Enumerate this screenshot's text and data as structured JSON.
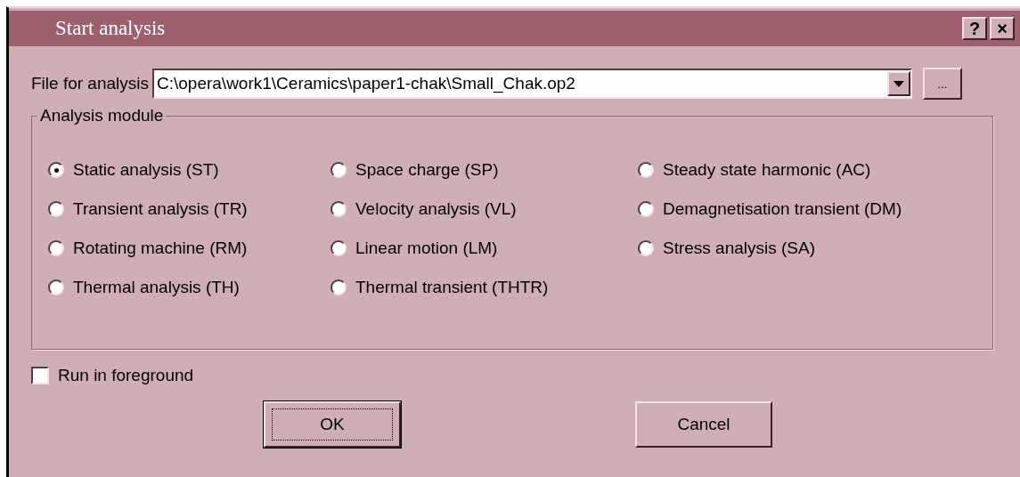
{
  "window": {
    "title": "Start analysis",
    "buttons": [
      {
        "label": "?"
      },
      {
        "label": "×"
      }
    ]
  },
  "file": {
    "label": "File for analysis",
    "value": "C:\\opera\\work1\\Ceramics\\paper1-chak\\Small_Chak.op2",
    "browse": "..."
  },
  "module": {
    "title": "Analysis module",
    "options": [
      {
        "label": "Static analysis (ST)",
        "selected": true
      },
      {
        "label": "Space charge (SP)",
        "selected": false
      },
      {
        "label": "Steady state harmonic (AC)",
        "selected": false
      },
      {
        "label": "Transient analysis (TR)",
        "selected": false
      },
      {
        "label": "Velocity analysis (VL)",
        "selected": false
      },
      {
        "label": "Demagnetisation transient (DM)",
        "selected": false
      },
      {
        "label": "Rotating machine (RM)",
        "selected": false
      },
      {
        "label": "Linear motion (LM)",
        "selected": false
      },
      {
        "label": "Stress analysis (SA)",
        "selected": false
      },
      {
        "label": "Thermal analysis (TH)",
        "selected": false
      },
      {
        "label": "Thermal transient (THTR)",
        "selected": false
      }
    ]
  },
  "foreground": {
    "label": "Run in foreground",
    "checked": false
  },
  "buttons": [
    {
      "label": "OK",
      "focused": true
    },
    {
      "label": "Cancel",
      "focused": false
    }
  ]
}
